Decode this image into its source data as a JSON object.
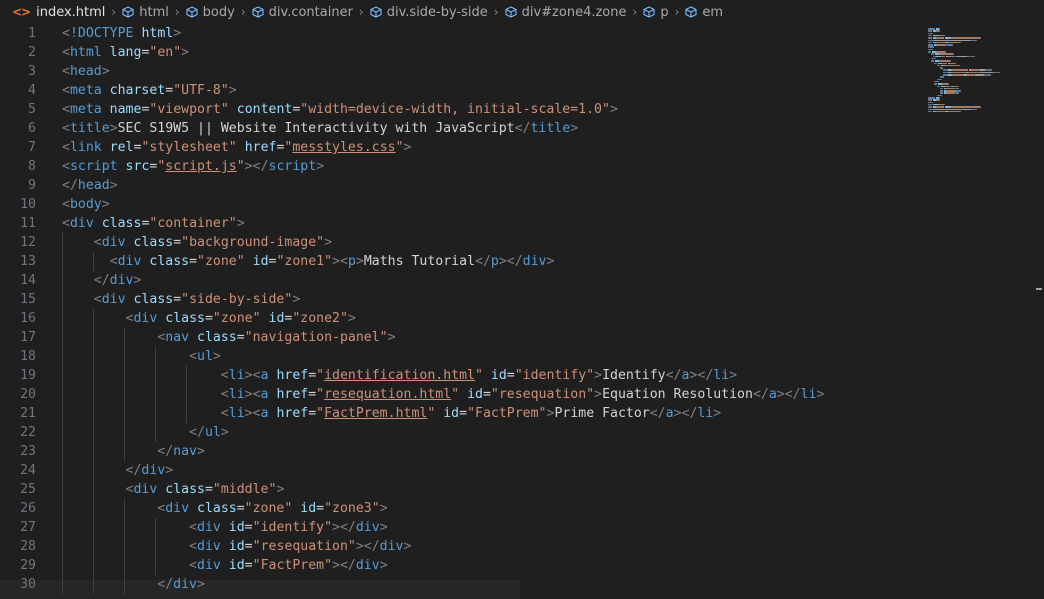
{
  "breadcrumbs": {
    "file": "index.html",
    "file_icon": "<>",
    "symbols": [
      "html",
      "body",
      "div.container",
      "div.side-by-side",
      "div#zone4.zone",
      "p",
      "em"
    ]
  },
  "line_numbers": [
    "1",
    "2",
    "3",
    "4",
    "5",
    "6",
    "7",
    "8",
    "9",
    "10",
    "11",
    "12",
    "13",
    "14",
    "15",
    "16",
    "17",
    "18",
    "19",
    "20",
    "21",
    "22",
    "23",
    "24",
    "25",
    "26",
    "27",
    "28",
    "29",
    "30"
  ],
  "code_lines": [
    [
      [
        "t",
        "<"
      ],
      [
        "tag",
        "!DOCTYPE"
      ],
      [
        "txt",
        " "
      ],
      [
        "attr",
        "html"
      ],
      [
        "t",
        ">"
      ]
    ],
    [
      [
        "t",
        "<"
      ],
      [
        "tag",
        "html"
      ],
      [
        "txt",
        " "
      ],
      [
        "attr",
        "lang"
      ],
      [
        "txt",
        "="
      ],
      [
        "str",
        "\"en\""
      ],
      [
        "t",
        ">"
      ]
    ],
    [
      [
        "t",
        "<"
      ],
      [
        "tag",
        "head"
      ],
      [
        "t",
        ">"
      ]
    ],
    [
      [
        "t",
        "<"
      ],
      [
        "tag",
        "meta"
      ],
      [
        "txt",
        " "
      ],
      [
        "attr",
        "charset"
      ],
      [
        "txt",
        "="
      ],
      [
        "str",
        "\"UTF-8\""
      ],
      [
        "t",
        ">"
      ]
    ],
    [
      [
        "t",
        "<"
      ],
      [
        "tag",
        "meta"
      ],
      [
        "txt",
        " "
      ],
      [
        "attr",
        "name"
      ],
      [
        "txt",
        "="
      ],
      [
        "str",
        "\"viewport\""
      ],
      [
        "txt",
        " "
      ],
      [
        "attr",
        "content"
      ],
      [
        "txt",
        "="
      ],
      [
        "str",
        "\"width=device-width, initial-scale=1.0\""
      ],
      [
        "t",
        ">"
      ]
    ],
    [
      [
        "t",
        "<"
      ],
      [
        "tag",
        "title"
      ],
      [
        "t",
        ">"
      ],
      [
        "txt",
        "SEC S19W5 || Website Interactivity with JavaScript"
      ],
      [
        "t",
        "</"
      ],
      [
        "tag",
        "title"
      ],
      [
        "t",
        ">"
      ]
    ],
    [
      [
        "t",
        "<"
      ],
      [
        "tag",
        "link"
      ],
      [
        "txt",
        " "
      ],
      [
        "attr",
        "rel"
      ],
      [
        "txt",
        "="
      ],
      [
        "str",
        "\"stylesheet\""
      ],
      [
        "txt",
        " "
      ],
      [
        "attr",
        "href"
      ],
      [
        "txt",
        "="
      ],
      [
        "str",
        "\""
      ],
      [
        "strl",
        "messtyles.css"
      ],
      [
        "str",
        "\""
      ],
      [
        "t",
        ">"
      ]
    ],
    [
      [
        "t",
        "<"
      ],
      [
        "tag",
        "script"
      ],
      [
        "txt",
        " "
      ],
      [
        "attr",
        "src"
      ],
      [
        "txt",
        "="
      ],
      [
        "str",
        "\""
      ],
      [
        "strl",
        "script.js"
      ],
      [
        "str",
        "\""
      ],
      [
        "t",
        "></"
      ],
      [
        "tag",
        "script"
      ],
      [
        "t",
        ">"
      ]
    ],
    [
      [
        "t",
        "</"
      ],
      [
        "tag",
        "head"
      ],
      [
        "t",
        ">"
      ]
    ],
    [
      [
        "t",
        "<"
      ],
      [
        "tag",
        "body"
      ],
      [
        "t",
        ">"
      ]
    ],
    [
      [
        "t",
        "<"
      ],
      [
        "tag",
        "div"
      ],
      [
        "txt",
        " "
      ],
      [
        "attr",
        "class"
      ],
      [
        "txt",
        "="
      ],
      [
        "str",
        "\"container\""
      ],
      [
        "t",
        ">"
      ]
    ],
    [
      [
        "txt",
        "    "
      ],
      [
        "t",
        "<"
      ],
      [
        "tag",
        "div"
      ],
      [
        "txt",
        " "
      ],
      [
        "attr",
        "class"
      ],
      [
        "txt",
        "="
      ],
      [
        "str",
        "\"background-image\""
      ],
      [
        "t",
        ">"
      ]
    ],
    [
      [
        "txt",
        "      "
      ],
      [
        "t",
        "<"
      ],
      [
        "tag",
        "div"
      ],
      [
        "txt",
        " "
      ],
      [
        "attr",
        "class"
      ],
      [
        "txt",
        "="
      ],
      [
        "str",
        "\"zone\""
      ],
      [
        "txt",
        " "
      ],
      [
        "attr",
        "id"
      ],
      [
        "txt",
        "="
      ],
      [
        "str",
        "\"zone1\""
      ],
      [
        "t",
        "><"
      ],
      [
        "tag",
        "p"
      ],
      [
        "t",
        ">"
      ],
      [
        "txt",
        "Maths Tutorial"
      ],
      [
        "t",
        "</"
      ],
      [
        "tag",
        "p"
      ],
      [
        "t",
        "></"
      ],
      [
        "tag",
        "div"
      ],
      [
        "t",
        ">"
      ]
    ],
    [
      [
        "txt",
        "    "
      ],
      [
        "t",
        "</"
      ],
      [
        "tag",
        "div"
      ],
      [
        "t",
        ">"
      ]
    ],
    [
      [
        "txt",
        "    "
      ],
      [
        "t",
        "<"
      ],
      [
        "tag",
        "div"
      ],
      [
        "txt",
        " "
      ],
      [
        "attr",
        "class"
      ],
      [
        "txt",
        "="
      ],
      [
        "str",
        "\"side-by-side\""
      ],
      [
        "t",
        ">"
      ]
    ],
    [
      [
        "txt",
        "        "
      ],
      [
        "t",
        "<"
      ],
      [
        "tag",
        "div"
      ],
      [
        "txt",
        " "
      ],
      [
        "attr",
        "class"
      ],
      [
        "txt",
        "="
      ],
      [
        "str",
        "\"zone\""
      ],
      [
        "txt",
        " "
      ],
      [
        "attr",
        "id"
      ],
      [
        "txt",
        "="
      ],
      [
        "str",
        "\"zone2\""
      ],
      [
        "t",
        ">"
      ]
    ],
    [
      [
        "txt",
        "            "
      ],
      [
        "t",
        "<"
      ],
      [
        "tag",
        "nav"
      ],
      [
        "txt",
        " "
      ],
      [
        "attr",
        "class"
      ],
      [
        "txt",
        "="
      ],
      [
        "str",
        "\"navigation-panel\""
      ],
      [
        "t",
        ">"
      ]
    ],
    [
      [
        "txt",
        "                "
      ],
      [
        "t",
        "<"
      ],
      [
        "tag",
        "ul"
      ],
      [
        "t",
        ">"
      ]
    ],
    [
      [
        "txt",
        "                    "
      ],
      [
        "t",
        "<"
      ],
      [
        "tag",
        "li"
      ],
      [
        "t",
        "><"
      ],
      [
        "tag",
        "a"
      ],
      [
        "txt",
        " "
      ],
      [
        "attr",
        "href"
      ],
      [
        "txt",
        "="
      ],
      [
        "str",
        "\""
      ],
      [
        "strl",
        "identification.html"
      ],
      [
        "str",
        "\""
      ],
      [
        "txt",
        " "
      ],
      [
        "attr",
        "id"
      ],
      [
        "txt",
        "="
      ],
      [
        "str",
        "\"identify\""
      ],
      [
        "t",
        ">"
      ],
      [
        "txt",
        "Identify"
      ],
      [
        "t",
        "</"
      ],
      [
        "tag",
        "a"
      ],
      [
        "t",
        "></"
      ],
      [
        "tag",
        "li"
      ],
      [
        "t",
        ">"
      ]
    ],
    [
      [
        "txt",
        "                    "
      ],
      [
        "t",
        "<"
      ],
      [
        "tag",
        "li"
      ],
      [
        "t",
        "><"
      ],
      [
        "tag",
        "a"
      ],
      [
        "txt",
        " "
      ],
      [
        "attr",
        "href"
      ],
      [
        "txt",
        "="
      ],
      [
        "str",
        "\""
      ],
      [
        "strl",
        "resequation.html"
      ],
      [
        "str",
        "\""
      ],
      [
        "txt",
        " "
      ],
      [
        "attr",
        "id"
      ],
      [
        "txt",
        "="
      ],
      [
        "str",
        "\"resequation\""
      ],
      [
        "t",
        ">"
      ],
      [
        "txt",
        "Equation Resolution"
      ],
      [
        "t",
        "</"
      ],
      [
        "tag",
        "a"
      ],
      [
        "t",
        "></"
      ],
      [
        "tag",
        "li"
      ],
      [
        "t",
        ">"
      ]
    ],
    [
      [
        "txt",
        "                    "
      ],
      [
        "t",
        "<"
      ],
      [
        "tag",
        "li"
      ],
      [
        "t",
        "><"
      ],
      [
        "tag",
        "a"
      ],
      [
        "txt",
        " "
      ],
      [
        "attr",
        "href"
      ],
      [
        "txt",
        "="
      ],
      [
        "str",
        "\""
      ],
      [
        "strl",
        "FactPrem.html"
      ],
      [
        "str",
        "\""
      ],
      [
        "txt",
        " "
      ],
      [
        "attr",
        "id"
      ],
      [
        "txt",
        "="
      ],
      [
        "str",
        "\"FactPrem\""
      ],
      [
        "t",
        ">"
      ],
      [
        "txt",
        "Prime Factor"
      ],
      [
        "t",
        "</"
      ],
      [
        "tag",
        "a"
      ],
      [
        "t",
        "></"
      ],
      [
        "tag",
        "li"
      ],
      [
        "t",
        ">"
      ]
    ],
    [
      [
        "txt",
        "                "
      ],
      [
        "t",
        "</"
      ],
      [
        "tag",
        "ul"
      ],
      [
        "t",
        ">"
      ]
    ],
    [
      [
        "txt",
        "            "
      ],
      [
        "t",
        "</"
      ],
      [
        "tag",
        "nav"
      ],
      [
        "t",
        ">"
      ]
    ],
    [
      [
        "txt",
        "        "
      ],
      [
        "t",
        "</"
      ],
      [
        "tag",
        "div"
      ],
      [
        "t",
        ">"
      ]
    ],
    [
      [
        "txt",
        "        "
      ],
      [
        "t",
        "<"
      ],
      [
        "tag",
        "div"
      ],
      [
        "txt",
        " "
      ],
      [
        "attr",
        "class"
      ],
      [
        "txt",
        "="
      ],
      [
        "str",
        "\"middle\""
      ],
      [
        "t",
        ">"
      ]
    ],
    [
      [
        "txt",
        "            "
      ],
      [
        "t",
        "<"
      ],
      [
        "tag",
        "div"
      ],
      [
        "txt",
        " "
      ],
      [
        "attr",
        "class"
      ],
      [
        "txt",
        "="
      ],
      [
        "str",
        "\"zone\""
      ],
      [
        "txt",
        " "
      ],
      [
        "attr",
        "id"
      ],
      [
        "txt",
        "="
      ],
      [
        "str",
        "\"zone3\""
      ],
      [
        "t",
        ">"
      ]
    ],
    [
      [
        "txt",
        "                "
      ],
      [
        "t",
        "<"
      ],
      [
        "tag",
        "div"
      ],
      [
        "txt",
        " "
      ],
      [
        "attr",
        "id"
      ],
      [
        "txt",
        "="
      ],
      [
        "str",
        "\"identify\""
      ],
      [
        "t",
        "></"
      ],
      [
        "tag",
        "div"
      ],
      [
        "t",
        ">"
      ]
    ],
    [
      [
        "txt",
        "                "
      ],
      [
        "t",
        "<"
      ],
      [
        "tag",
        "div"
      ],
      [
        "txt",
        " "
      ],
      [
        "attr",
        "id"
      ],
      [
        "txt",
        "="
      ],
      [
        "str",
        "\"resequation\""
      ],
      [
        "t",
        "></"
      ],
      [
        "tag",
        "div"
      ],
      [
        "t",
        ">"
      ]
    ],
    [
      [
        "txt",
        "                "
      ],
      [
        "t",
        "<"
      ],
      [
        "tag",
        "div"
      ],
      [
        "txt",
        " "
      ],
      [
        "attr",
        "id"
      ],
      [
        "txt",
        "="
      ],
      [
        "str",
        "\"FactPrem\""
      ],
      [
        "t",
        "></"
      ],
      [
        "tag",
        "div"
      ],
      [
        "t",
        ">"
      ]
    ],
    [
      [
        "txt",
        "            "
      ],
      [
        "t",
        "</"
      ],
      [
        "tag",
        "div"
      ],
      [
        "t",
        ">"
      ]
    ]
  ],
  "colors": {
    "background": "#1f1f1f",
    "tag": "#569cd6",
    "attribute": "#9cdcfe",
    "string": "#ce9178",
    "text": "#d4d4d4",
    "bracket": "#808080",
    "line_number": "#6e7681",
    "file_icon": "#e37933"
  }
}
